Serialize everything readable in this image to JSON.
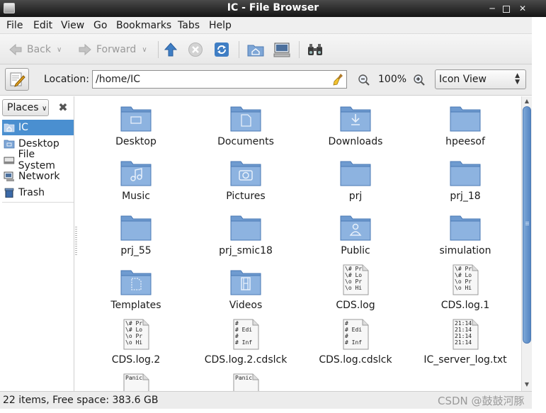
{
  "window": {
    "title": "IC - File Browser"
  },
  "menu": [
    "File",
    "Edit",
    "View",
    "Go",
    "Bookmarks",
    "Tabs",
    "Help"
  ],
  "toolbar": {
    "back_label": "Back",
    "forward_label": "Forward"
  },
  "location": {
    "label": "Location:",
    "value": "/home/IC",
    "zoom": "100%",
    "view_mode": "Icon View"
  },
  "sidebar": {
    "selector_label": "Places",
    "items": [
      {
        "label": "IC",
        "icon": "home-folder-icon",
        "selected": true
      },
      {
        "label": "Desktop",
        "icon": "desktop-folder-icon"
      },
      {
        "label": "File System",
        "icon": "drive-icon"
      },
      {
        "label": "Network",
        "icon": "network-icon"
      },
      {
        "label": "Trash",
        "icon": "trash-icon"
      }
    ]
  },
  "files": [
    {
      "name": "Desktop",
      "kind": "folder",
      "emblem": "desktop"
    },
    {
      "name": "Documents",
      "kind": "folder",
      "emblem": "documents"
    },
    {
      "name": "Downloads",
      "kind": "folder",
      "emblem": "download"
    },
    {
      "name": "hpeesof",
      "kind": "folder",
      "emblem": ""
    },
    {
      "name": "Music",
      "kind": "folder",
      "emblem": "music"
    },
    {
      "name": "Pictures",
      "kind": "folder",
      "emblem": "camera"
    },
    {
      "name": "prj",
      "kind": "folder",
      "emblem": ""
    },
    {
      "name": "prj_18",
      "kind": "folder",
      "emblem": ""
    },
    {
      "name": "prj_55",
      "kind": "folder",
      "emblem": ""
    },
    {
      "name": "prj_smic18",
      "kind": "folder",
      "emblem": ""
    },
    {
      "name": "Public",
      "kind": "folder",
      "emblem": "person"
    },
    {
      "name": "simulation",
      "kind": "folder",
      "emblem": ""
    },
    {
      "name": "Templates",
      "kind": "folder",
      "emblem": "template"
    },
    {
      "name": "Videos",
      "kind": "folder",
      "emblem": "film"
    },
    {
      "name": "CDS.log",
      "kind": "text",
      "preview": [
        "\\# Pr",
        "\\# Lo",
        "\\o Pr",
        "\\o Hi"
      ]
    },
    {
      "name": "CDS.log.1",
      "kind": "text",
      "preview": [
        "\\# Pr",
        "\\# Lo",
        "\\o Pr",
        "\\o Hi"
      ]
    },
    {
      "name": "CDS.log.2",
      "kind": "text",
      "preview": [
        "\\# Pr",
        "\\# Lo",
        "\\o Pr",
        "\\o Hi"
      ]
    },
    {
      "name": "CDS.log.2.cdslck",
      "kind": "text",
      "preview": [
        "#",
        "# Edi",
        "#",
        "# Inf"
      ]
    },
    {
      "name": "CDS.log.cdslck",
      "kind": "text",
      "preview": [
        "#",
        "# Edi",
        "#",
        "# Inf"
      ]
    },
    {
      "name": "IC_server_log.txt",
      "kind": "text",
      "preview": [
        "21:14",
        "21:14",
        "21:14",
        "21:14"
      ]
    },
    {
      "name": "",
      "kind": "text",
      "preview": [
        "Panic"
      ]
    },
    {
      "name": "",
      "kind": "text",
      "preview": [
        "Panic"
      ]
    }
  ],
  "status": {
    "text": "22 items, Free space: 383.6 GB"
  },
  "watermark": "CSDN @鼓鼓河豚",
  "colors": {
    "accent": "#4a8fd0",
    "folder": "#7ea6d6",
    "titlebar": "#2b2b2b"
  }
}
